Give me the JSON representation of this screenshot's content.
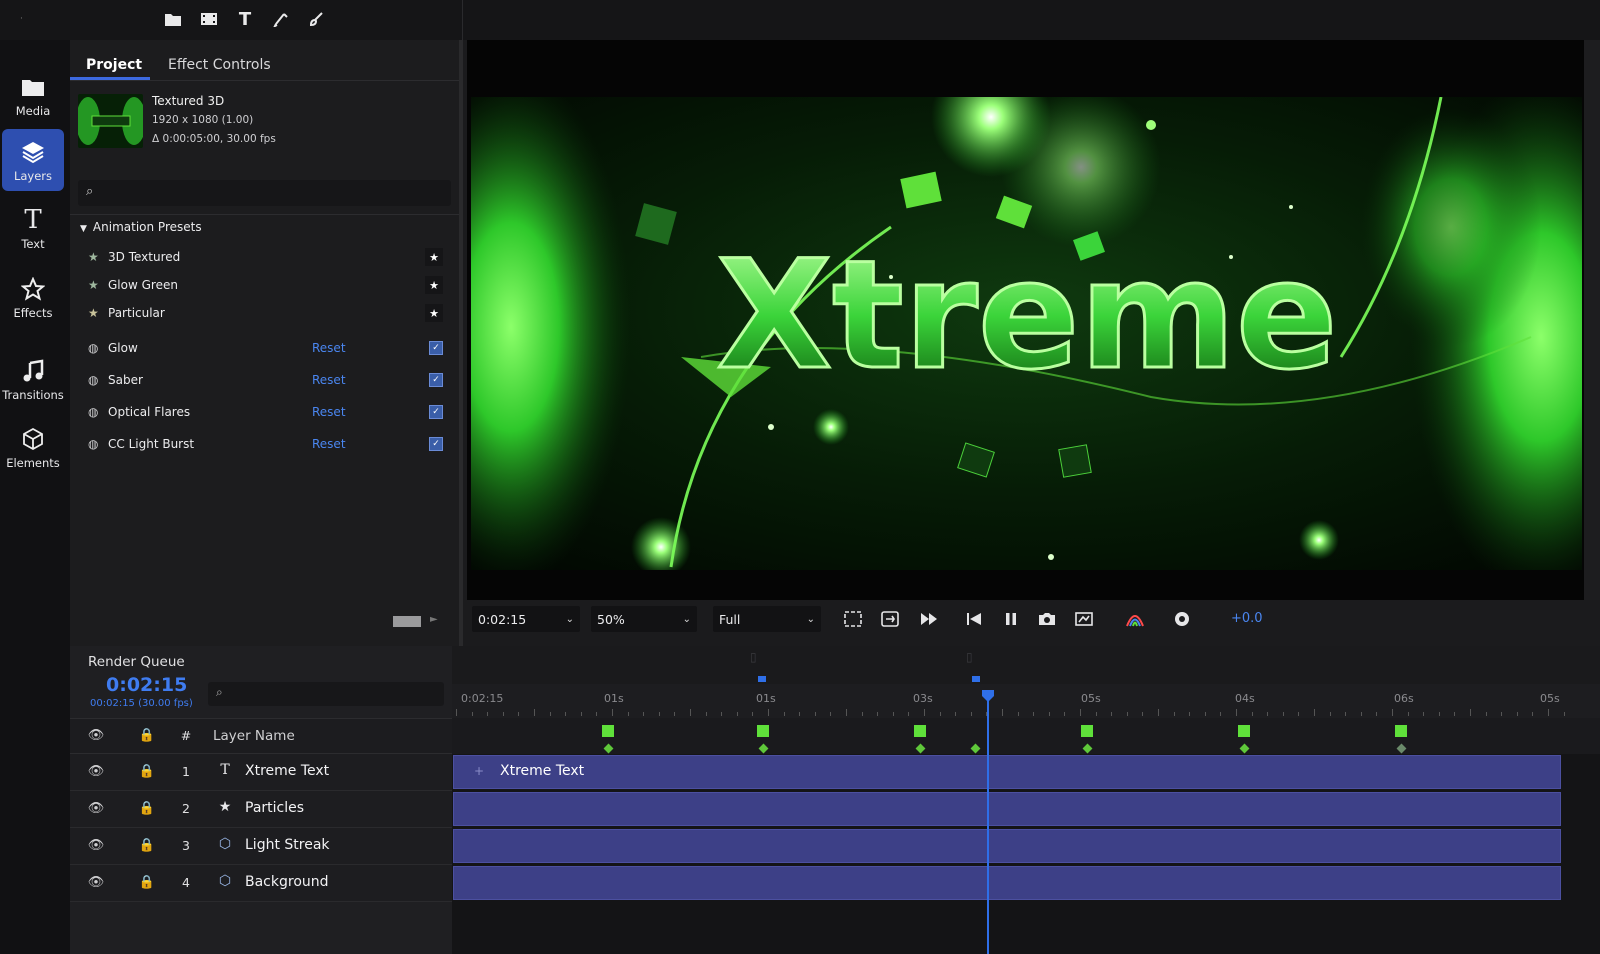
{
  "colors": {
    "accent": "#3f7cf0",
    "keyframe": "#5fe03a",
    "clip": "#3d4087"
  },
  "toolbar": {
    "icons": [
      "folder-icon",
      "film-icon",
      "text-tool-icon",
      "pen-tool-icon",
      "brush-tool-icon"
    ],
    "text_tool_glyph": "T"
  },
  "rail": {
    "items": [
      {
        "label": "Media",
        "icon": "folder-icon"
      },
      {
        "label": "Layers",
        "icon": "layers-icon",
        "active": true
      },
      {
        "label": "Text",
        "icon": "text-icon"
      },
      {
        "label": "Effects",
        "icon": "star-icon"
      },
      {
        "label": "Transitions",
        "icon": "music-note-icon"
      },
      {
        "label": "Elements",
        "icon": "cube-icon"
      }
    ],
    "text_glyph": "T"
  },
  "panel": {
    "tabs": [
      "Project",
      "Effect Controls"
    ],
    "active_tab": "Project",
    "project": {
      "name": "Textured 3D",
      "resolution": "1920 x 1080 (1.00)",
      "duration": "Δ 0:00:05:00, 30.00 fps"
    },
    "search_placeholder": "",
    "presets_title": "Animation Presets",
    "presets": [
      "3D Textured",
      "Glow Green",
      "Particular"
    ],
    "effects": [
      {
        "label": "Glow",
        "reset": "Reset"
      },
      {
        "label": "Saber",
        "reset": "Reset"
      },
      {
        "label": "Optical Flares",
        "reset": "Reset"
      },
      {
        "label": "CC Light Burst",
        "reset": "Reset"
      }
    ]
  },
  "viewer": {
    "title_text": "Xtreme"
  },
  "controls": {
    "time": "0:02:15",
    "zoom": "50%",
    "quality": "Full",
    "offset": "+0.0"
  },
  "render_queue": {
    "title": "Render Queue",
    "timecode": "0:02:15",
    "timecode_sub": "00:02:15 (30.00 fps)",
    "search_placeholder": ""
  },
  "layers": {
    "header": {
      "hash": "#",
      "name": "Layer Name"
    },
    "rows": [
      {
        "num": "1",
        "name": "Xtreme Text",
        "type": "text"
      },
      {
        "num": "2",
        "name": "Particles",
        "type": "star"
      },
      {
        "num": "3",
        "name": "Light Streak",
        "type": "cube"
      },
      {
        "num": "4",
        "name": "Background",
        "type": "cube"
      }
    ],
    "type_glyphs": {
      "text": "T",
      "star": "★",
      "cube": "⬡"
    }
  },
  "timeline": {
    "ruler_labels": [
      "0:02:15",
      "01s",
      "01s",
      "03s",
      "05s",
      "04s",
      "06s",
      "05s"
    ],
    "clip_label": "Xtreme Text",
    "clip_plus": "+"
  }
}
